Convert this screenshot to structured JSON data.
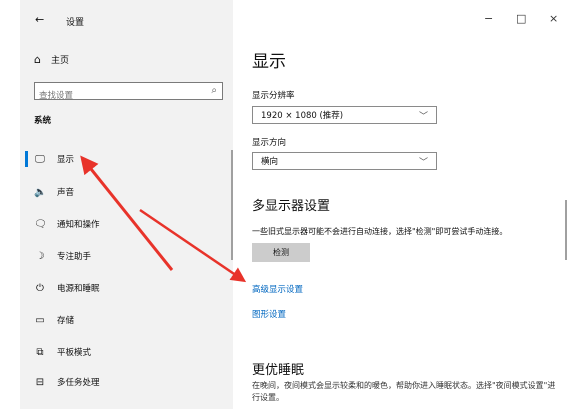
{
  "window": {
    "back": "←",
    "title": "设置",
    "minimize": "−",
    "maximize": "□",
    "close": "×"
  },
  "sidebar": {
    "home": "主页",
    "search_placeholder": "查找设置",
    "section": "系统",
    "items": [
      {
        "label": "显示",
        "icon": "monitor-icon",
        "glyph": "🖵"
      },
      {
        "label": "声音",
        "icon": "speaker-icon",
        "glyph": "🔈"
      },
      {
        "label": "通知和操作",
        "icon": "notification-icon",
        "glyph": "🗨"
      },
      {
        "label": "专注助手",
        "icon": "moon-icon",
        "glyph": "☽"
      },
      {
        "label": "电源和睡眠",
        "icon": "power-icon",
        "glyph": "⏻"
      },
      {
        "label": "存储",
        "icon": "storage-icon",
        "glyph": "▭"
      },
      {
        "label": "平板模式",
        "icon": "tablet-icon",
        "glyph": "⧉"
      },
      {
        "label": "多任务处理",
        "icon": "multitask-icon",
        "glyph": "⊟"
      }
    ]
  },
  "main": {
    "title": "显示",
    "resolution_label": "显示分辨率",
    "resolution_value": "1920 × 1080 (推荐)",
    "orientation_label": "显示方向",
    "orientation_value": "横向",
    "multi_title": "多显示器设置",
    "multi_desc": "一些旧式显示器可能不会进行自动连接，选择\"检测\"即可尝试手动连接。",
    "detect_button": "检测",
    "advanced_link": "高级显示设置",
    "graphics_link": "图形设置",
    "sleep_title": "更优睡眠",
    "sleep_desc": "在晚间，夜间模式会显示较柔和的暖色，帮助你进入睡眠状态。选择\"夜间模式设置\"进行设置。"
  },
  "annotation_color": "#e8332a",
  "accent_color": "#0078d7"
}
